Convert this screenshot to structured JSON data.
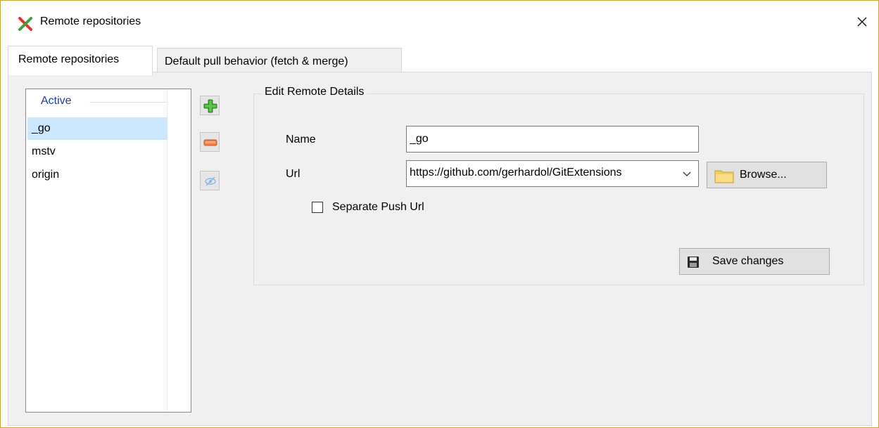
{
  "window": {
    "title": "Remote repositories",
    "app_icon": "git-extensions-x-icon",
    "close_icon": "close-icon"
  },
  "tabs": [
    {
      "label": "Remote repositories",
      "active": true
    },
    {
      "label": "Default pull behavior (fetch & merge)",
      "active": false
    }
  ],
  "remotes_list": {
    "group_header": "Active",
    "items": [
      {
        "label": "_go",
        "selected": true
      },
      {
        "label": "mstv",
        "selected": false
      },
      {
        "label": "origin",
        "selected": false
      }
    ]
  },
  "toolbar": {
    "add_icon": "green-plus-icon",
    "remove_icon": "orange-minus-icon",
    "toggle_icon": "eye-slash-icon"
  },
  "details": {
    "group_title": "Edit Remote Details",
    "name_label": "Name",
    "name_value": "_go",
    "url_label": "Url",
    "url_value": "https://github.com/gerhardol/GitExtensions",
    "browse_label": "Browse...",
    "browse_icon": "folder-icon",
    "separate_push_label": "Separate Push Url",
    "separate_push_checked": false,
    "save_label": "Save changes",
    "save_icon": "floppy-disk-icon"
  },
  "colors": {
    "accent_border": "#c9a43a",
    "selection": "#cce8ff",
    "group_header": "#1e3e9e",
    "panel_bg": "#f0f0f0"
  }
}
